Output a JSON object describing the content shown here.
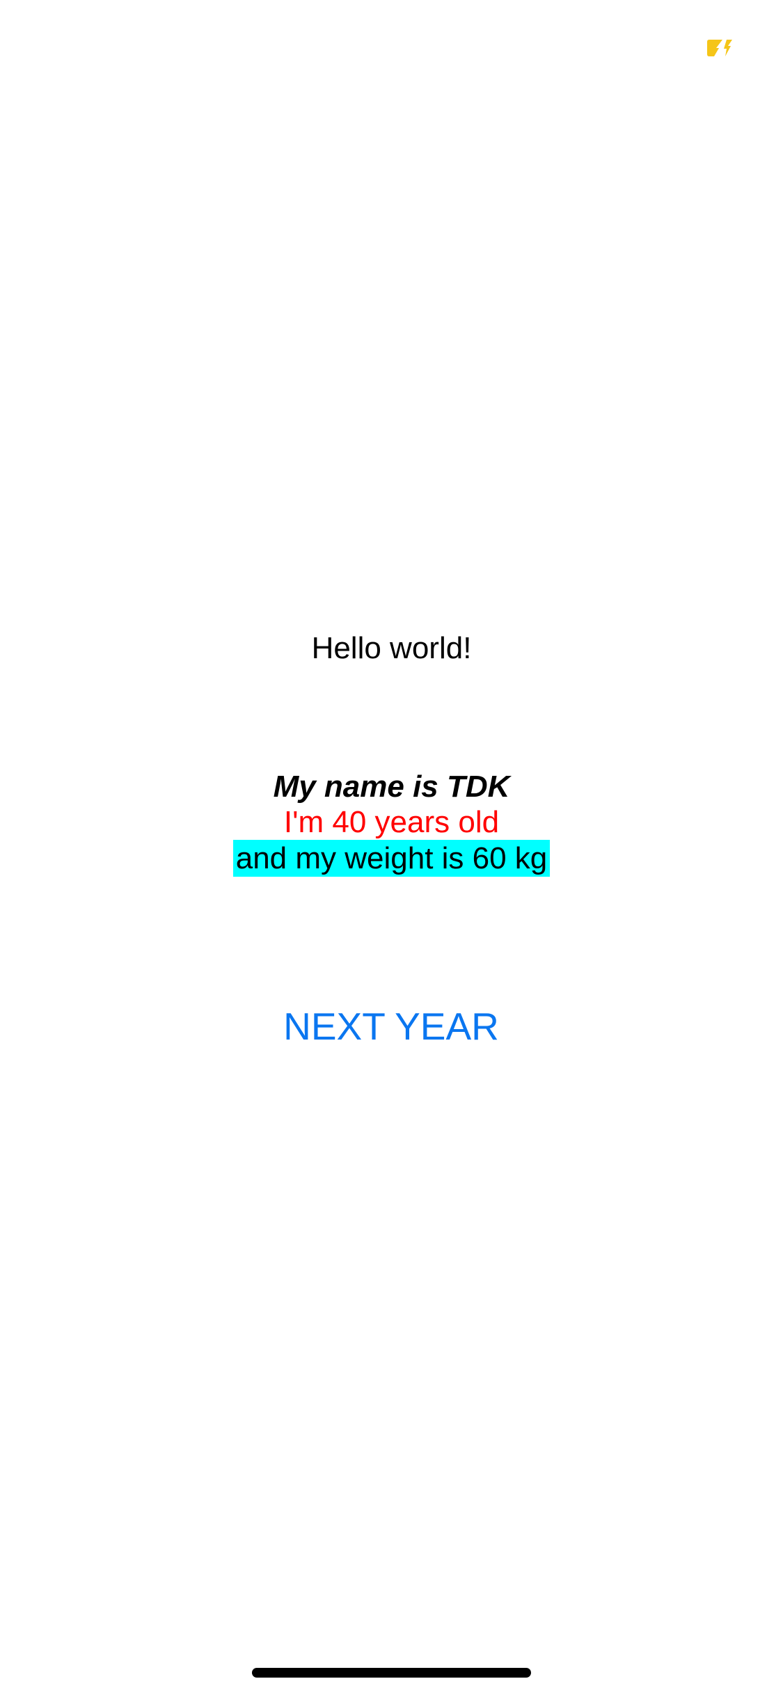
{
  "colors": {
    "background": "#ffffff",
    "status_indicator": "#f5c518",
    "age_text": "#ff0000",
    "weight_highlight": "#00ffff",
    "button_text": "#0a76f0",
    "home_indicator": "#000000"
  },
  "status_bar": {
    "indicator_icon": "charging-indicator-icon"
  },
  "greeting": "Hello world!",
  "info": {
    "name_line": "My name is TDK",
    "age_line": "I'm 40 years old",
    "weight_line": "and my weight is 60 kg"
  },
  "actions": {
    "next_year_label": "NEXT YEAR"
  }
}
